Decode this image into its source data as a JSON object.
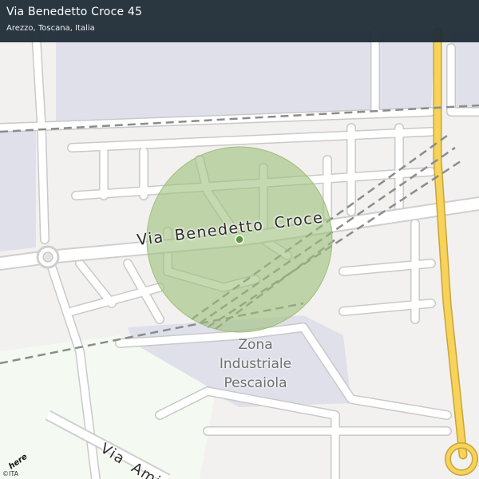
{
  "header": {
    "title": "Via Benedetto Croce 45",
    "subtitle": "Arezzo, Toscana, Italia"
  },
  "map": {
    "labels": {
      "main_street": "Via Benedetto Croce",
      "district_line1": "Zona",
      "district_line2": "Industriale",
      "district_line3": "Pescaiola",
      "lower_street": "Via Ami"
    },
    "logo_text": "here",
    "copyright": "©ITA",
    "colors": {
      "land": "#f2f1ef",
      "industrial": "#e0e0ea",
      "park": "#f4faf1",
      "highway": "#f7d35a",
      "accuracy_circle": "#9cc07a",
      "location_dot": "#5a9a3e",
      "header_bg": "#212e38"
    }
  }
}
